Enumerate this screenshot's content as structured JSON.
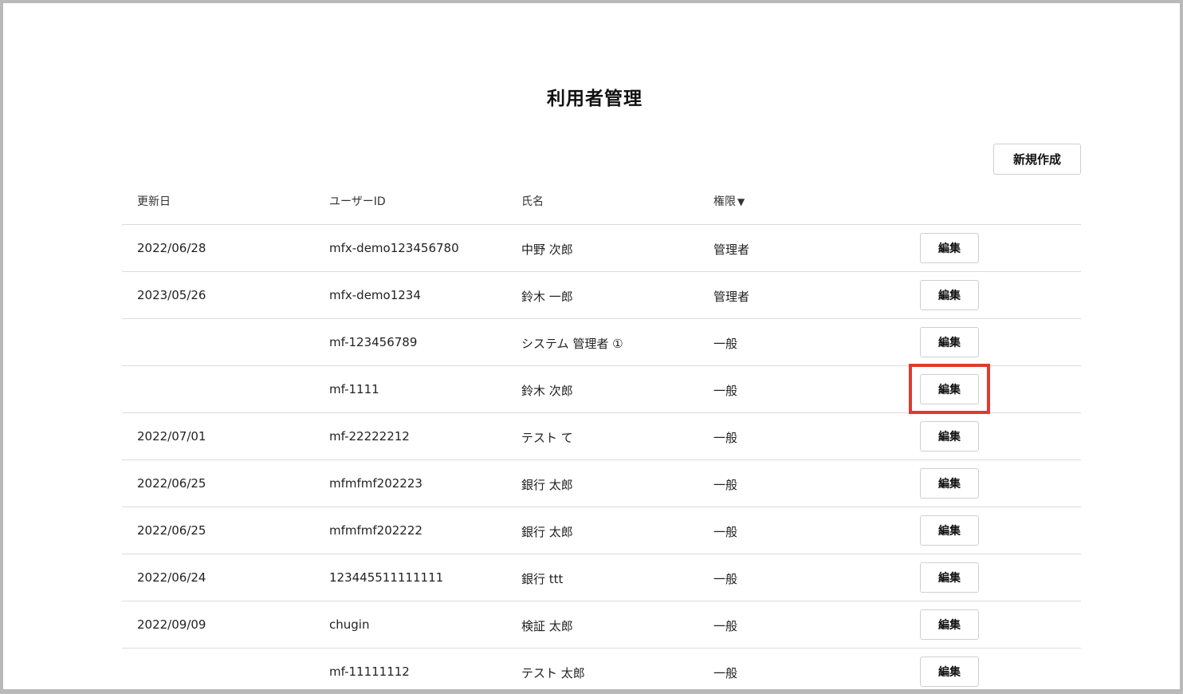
{
  "page": {
    "title": "利用者管理",
    "new_button_label": "新規作成"
  },
  "table": {
    "headers": {
      "updated_date": "更新日",
      "user_id": "ユーザーID",
      "name": "氏名",
      "role": "権限",
      "role_sort_indicator": "▼"
    },
    "edit_label": "編集",
    "rows": [
      {
        "date": "2022/06/28",
        "user_id": "mfx-demo123456780",
        "name": "中野 次郎",
        "role": "管理者"
      },
      {
        "date": "2023/05/26",
        "user_id": "mfx-demo1234",
        "name": "鈴木 一郎",
        "role": "管理者"
      },
      {
        "date": "",
        "user_id": "mf-123456789",
        "name": "システム 管理者 ①",
        "role": "一般"
      },
      {
        "date": "",
        "user_id": "mf-1111",
        "name": "鈴木 次郎",
        "role": "一般"
      },
      {
        "date": "2022/07/01",
        "user_id": "mf-22222212",
        "name": "テスト て",
        "role": "一般"
      },
      {
        "date": "2022/06/25",
        "user_id": "mfmfmf202223",
        "name": "銀行 太郎",
        "role": "一般"
      },
      {
        "date": "2022/06/25",
        "user_id": "mfmfmf202222",
        "name": "銀行 太郎",
        "role": "一般"
      },
      {
        "date": "2022/06/24",
        "user_id": "123445511111111",
        "name": "銀行 ttt",
        "role": "一般"
      },
      {
        "date": "2022/09/09",
        "user_id": "chugin",
        "name": "検証 太郎",
        "role": "一般"
      },
      {
        "date": "",
        "user_id": "mf-11111112",
        "name": "テスト 太郎",
        "role": "一般"
      }
    ]
  },
  "highlight": {
    "color": "#e03a2e"
  }
}
